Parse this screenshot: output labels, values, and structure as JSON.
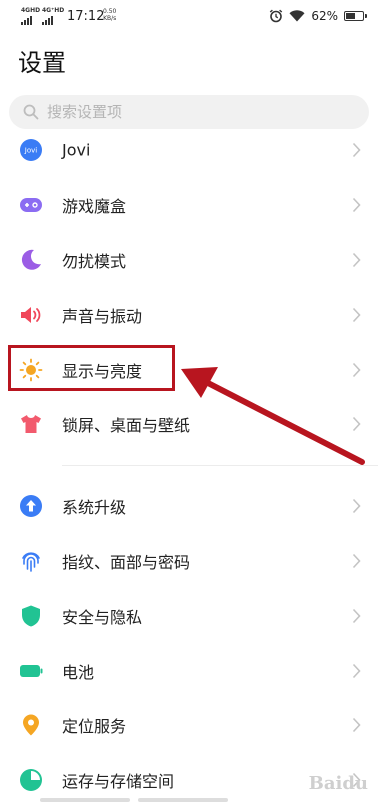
{
  "status_bar": {
    "sim1_label": "4GHD",
    "sim2_label": "4G⁺HD",
    "time": "17:12",
    "net_speed_value": "0.50",
    "net_speed_unit": "KB/s",
    "battery_percent": "62%",
    "battery_level": 0.62,
    "icons": [
      "alarm-icon",
      "wifi-icon",
      "battery-icon"
    ]
  },
  "page": {
    "title": "设置"
  },
  "search": {
    "placeholder": "搜索设置项"
  },
  "settings": [
    {
      "label": "Jovi",
      "icon": "jovi-icon",
      "color": "#3a7cf5"
    },
    {
      "label": "游戏魔盒",
      "icon": "game-controller-icon",
      "color": "#8b6cf2"
    },
    {
      "label": "勿扰模式",
      "icon": "moon-icon",
      "color": "#9b5de5"
    },
    {
      "label": "声音与振动",
      "icon": "speaker-icon",
      "color": "#f0475a"
    },
    {
      "label": "显示与亮度",
      "icon": "sun-icon",
      "color": "#f5a623"
    },
    {
      "label": "锁屏、桌面与壁纸",
      "icon": "tshirt-icon",
      "color": "#f25a6d"
    },
    {
      "label": "系统升级",
      "icon": "upgrade-arrow-icon",
      "color": "#3a7cf5"
    },
    {
      "label": "指纹、面部与密码",
      "icon": "fingerprint-icon",
      "color": "#3a7cf5"
    },
    {
      "label": "安全与隐私",
      "icon": "shield-icon",
      "color": "#21c393"
    },
    {
      "label": "电池",
      "icon": "battery-icon",
      "color": "#21c393"
    },
    {
      "label": "定位服务",
      "icon": "location-pin-icon",
      "color": "#f5a623"
    },
    {
      "label": "运存与存储空间",
      "icon": "pie-chart-icon",
      "color": "#21c393"
    }
  ],
  "annotation": {
    "highlight_color": "#b8151f"
  },
  "watermark": "Baidu"
}
